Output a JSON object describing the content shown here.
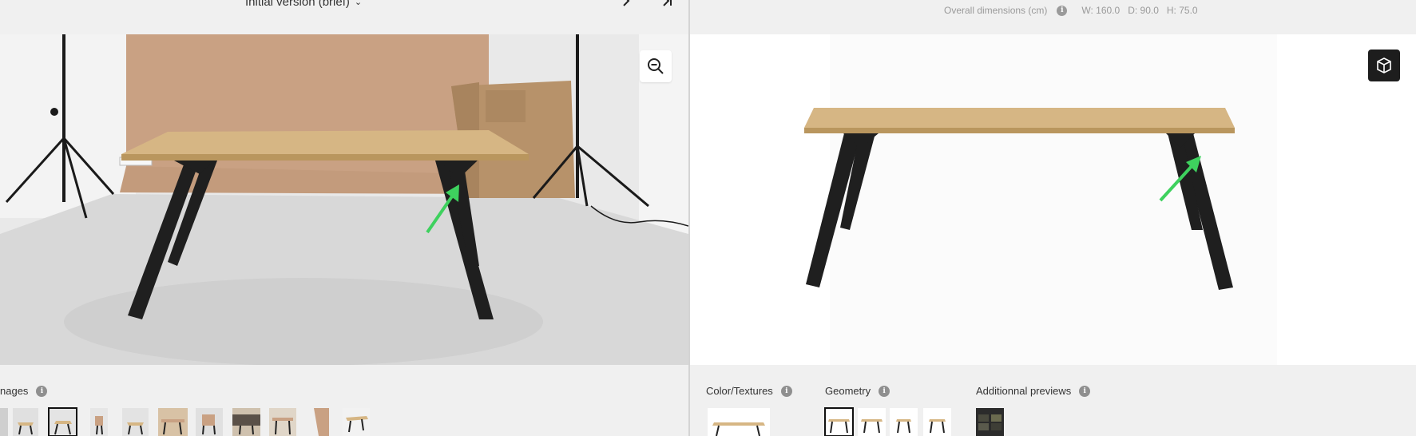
{
  "left": {
    "version_label": "Initial version (brief)",
    "images_label": "nages",
    "thumb_count": 11,
    "selected_thumb": 2
  },
  "right": {
    "dims_label": "Overall dimensions (cm)",
    "width": "W: 160.0",
    "depth": "D: 90.0",
    "height": "H: 75.0",
    "sections": {
      "textures": "Color/Textures",
      "geometry": "Geometry",
      "previews": "Additionnal previews"
    }
  },
  "icons": {
    "next": "chevron-right-icon",
    "last": "skip-to-end-icon",
    "zoom": "zoom-out-icon",
    "cube": "3d-cube-icon",
    "info": "info-icon"
  },
  "colors": {
    "tabletop": "#d1b27d",
    "legs": "#1f1f1f",
    "arrow": "#3ed15e",
    "backdrop": "#c9a183"
  }
}
